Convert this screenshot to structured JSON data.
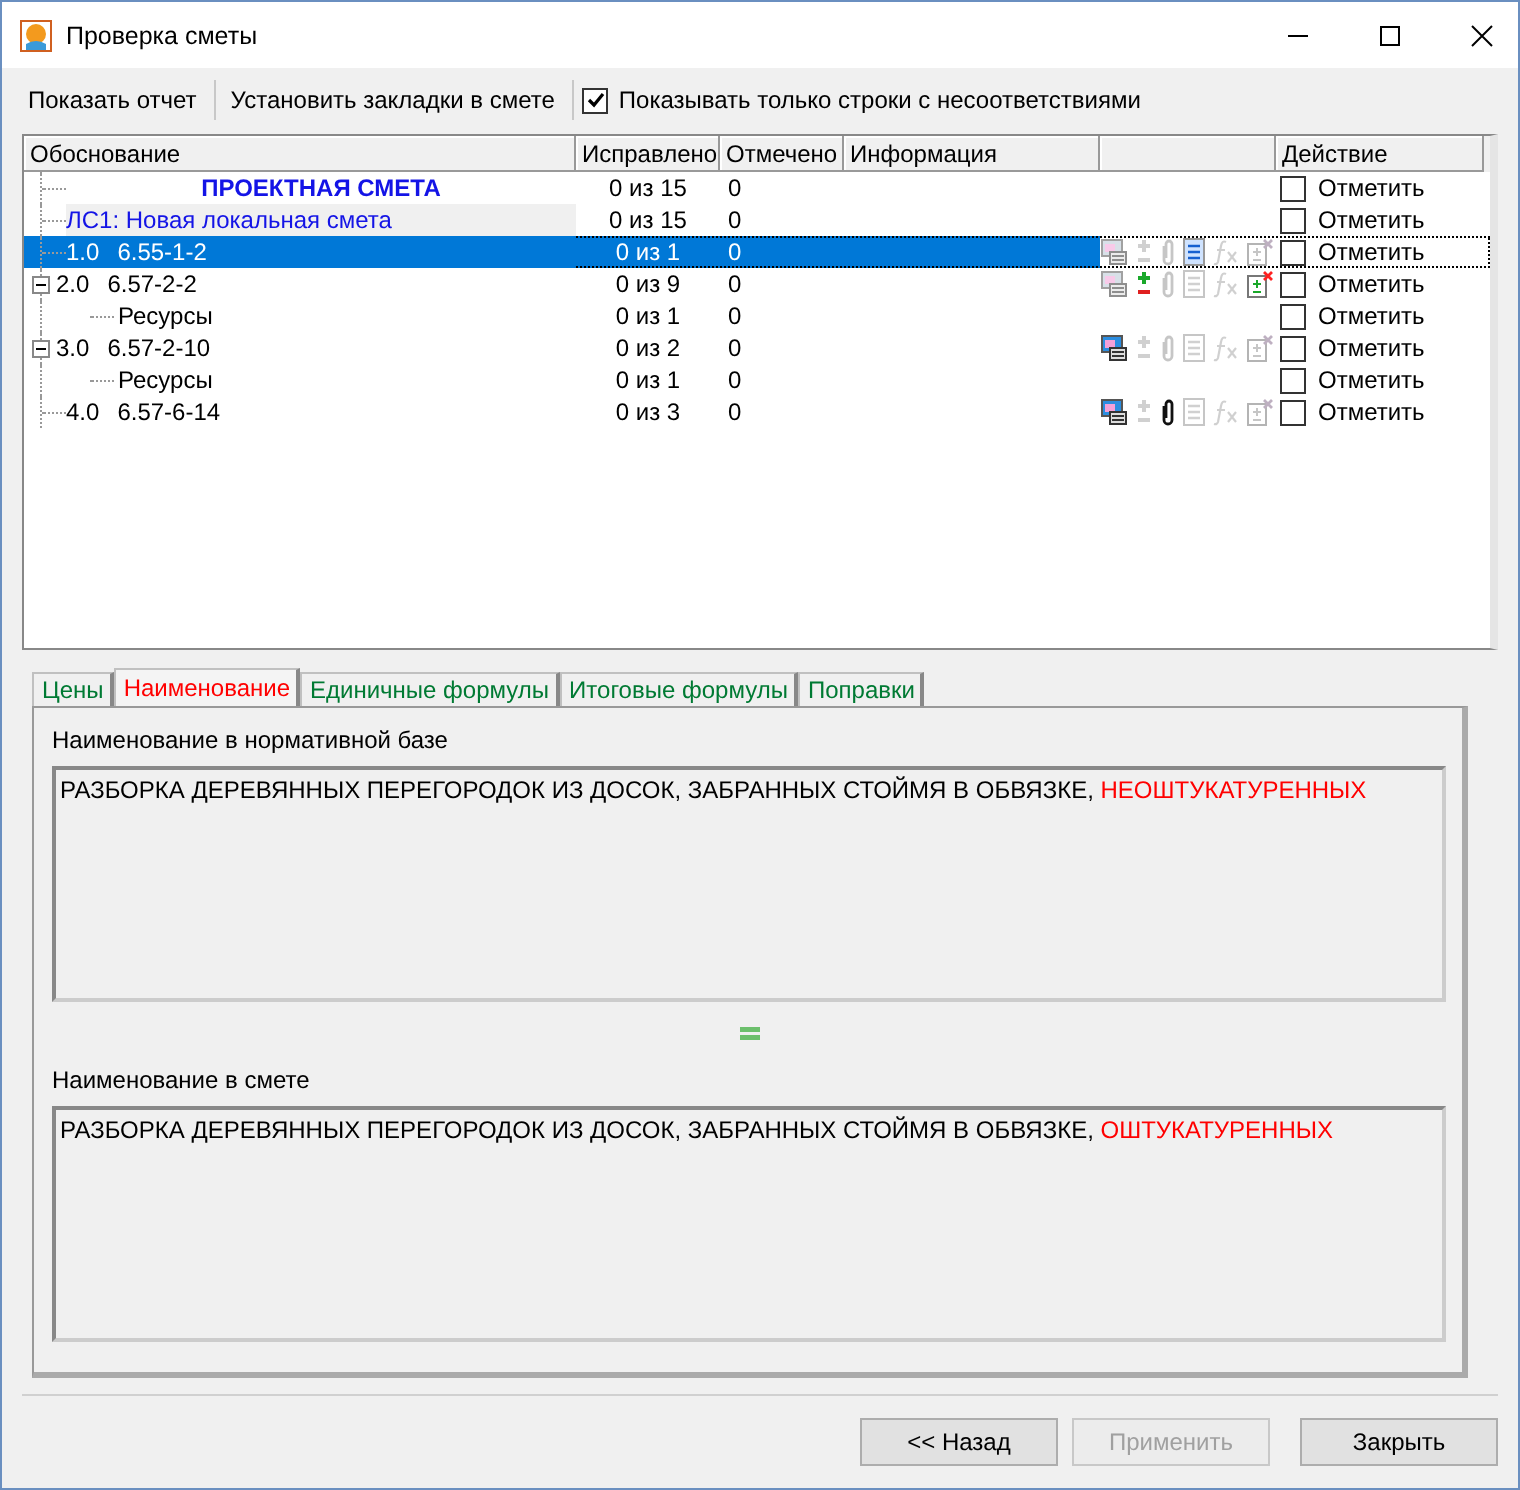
{
  "window": {
    "title": "Проверка сметы"
  },
  "toolbar": {
    "buttons": [
      "Показать отчет",
      "Установить закладки в смете"
    ],
    "filter": {
      "label": "Показывать только строки с несоответствиями",
      "checked": true
    }
  },
  "table": {
    "columns": [
      "Обоснование",
      "Исправлено",
      "Отмечено",
      "Информация",
      "Действие"
    ],
    "rows": [
      {
        "kind": "title",
        "name": "ПРОЕКТНАЯ СМЕТА",
        "fixed": "0 из 15",
        "marked": "0",
        "action": "Отметить",
        "checked": false,
        "selected": false
      },
      {
        "kind": "estimate",
        "name": "ЛС1: Новая локальная смета",
        "fixed": "0 из 15",
        "marked": "0",
        "action": "Отметить",
        "checked": false,
        "selected": false
      },
      {
        "kind": "item",
        "number": "1.0",
        "code": "6.55-1-2",
        "fixed": "0 из 1",
        "marked": "0",
        "action": "Отметить",
        "checked": false,
        "selected": true,
        "tools": [
          {
            "kind": "sheet",
            "active": false
          },
          {
            "kind": "plusminus",
            "active": false
          },
          {
            "kind": "clip",
            "active": false
          },
          {
            "kind": "doc",
            "active": true
          },
          {
            "kind": "fx",
            "active": false
          },
          {
            "kind": "paste",
            "active": false
          }
        ]
      },
      {
        "kind": "item",
        "number": "2.0",
        "code": "6.57-2-2",
        "fixed": "0 из 9",
        "marked": "0",
        "action": "Отметить",
        "checked": false,
        "selected": false,
        "expanded": true,
        "tools": [
          {
            "kind": "sheet",
            "active": false
          },
          {
            "kind": "plusminus",
            "active": true
          },
          {
            "kind": "clip",
            "active": false
          },
          {
            "kind": "doc",
            "active": false
          },
          {
            "kind": "fx",
            "active": false
          },
          {
            "kind": "paste",
            "active": true
          }
        ],
        "children": [
          {
            "kind": "resource",
            "name": "Ресурсы",
            "fixed": "0 из 1",
            "marked": "0",
            "action": "Отметить",
            "checked": false,
            "selected": false
          }
        ]
      },
      {
        "kind": "item",
        "number": "3.0",
        "code": "6.57-2-10",
        "fixed": "0 из 2",
        "marked": "0",
        "action": "Отметить",
        "checked": false,
        "selected": false,
        "expanded": true,
        "tools": [
          {
            "kind": "sheet",
            "active": true
          },
          {
            "kind": "plusminus",
            "active": false
          },
          {
            "kind": "clip",
            "active": false
          },
          {
            "kind": "doc",
            "active": false
          },
          {
            "kind": "fx",
            "active": false
          },
          {
            "kind": "paste",
            "active": false
          }
        ],
        "children": [
          {
            "kind": "resource",
            "name": "Ресурсы",
            "fixed": "0 из 1",
            "marked": "0",
            "action": "Отметить",
            "checked": false,
            "selected": false
          }
        ]
      },
      {
        "kind": "item",
        "number": "4.0",
        "code": "6.57-6-14",
        "fixed": "0 из 3",
        "marked": "0",
        "action": "Отметить",
        "checked": false,
        "selected": false,
        "tools": [
          {
            "kind": "sheet",
            "active": true
          },
          {
            "kind": "plusminus",
            "active": false
          },
          {
            "kind": "clip",
            "active": true
          },
          {
            "kind": "doc",
            "active": false
          },
          {
            "kind": "fx",
            "active": false
          },
          {
            "kind": "paste",
            "active": false
          }
        ]
      }
    ]
  },
  "tabs": [
    {
      "label": "Цены",
      "selected": false,
      "color": "#007a33"
    },
    {
      "label": "Наименование",
      "selected": true,
      "color": "#ff0000"
    },
    {
      "label": "Единичные формулы",
      "selected": false,
      "color": "#007a33"
    },
    {
      "label": "Итоговые формулы",
      "selected": false,
      "color": "#007a33"
    },
    {
      "label": "Поправки",
      "selected": false,
      "color": "#007a33"
    }
  ],
  "comparison": [
    {
      "label": "Наименование в нормативной базе",
      "text": "РАЗБОРКА ДЕРЕВЯННЫХ ПЕРЕГОРОДОК ИЗ ДОСОК, ЗАБРАННЫХ СТОЙМЯ В ОБВЯЗКЕ, ",
      "difference": "НЕОШТУКАТУРЕННЫХ"
    },
    {
      "label": "Наименование в смете",
      "text": "РАЗБОРКА ДЕРЕВЯННЫХ ПЕРЕГОРОДОК ИЗ ДОСОК, ЗАБРАННЫХ СТОЙМЯ В ОБВЯЗКЕ, ",
      "difference": "ОШТУКАТУРЕННЫХ"
    }
  ],
  "buttons": [
    {
      "label": "<< Назад",
      "disabled": false
    },
    {
      "label": "Применить",
      "disabled": true
    },
    {
      "label": "Закрыть",
      "disabled": false
    }
  ]
}
